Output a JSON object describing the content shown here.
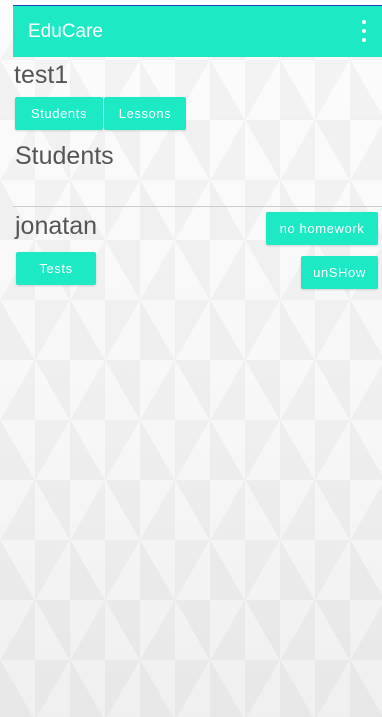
{
  "app": {
    "title": "EduCare",
    "menu_icon": "overflow-menu-icon",
    "accent_color": "#1de9c5"
  },
  "class_view": {
    "name": "test1",
    "tabs": {
      "students_label": "Students",
      "lessons_label": "Lessons"
    },
    "section_title": "Students",
    "students": [
      {
        "name": "jonatan",
        "homework_label": "no homework",
        "tests_label": "Tests",
        "unshow_label": "unSHow"
      }
    ]
  }
}
